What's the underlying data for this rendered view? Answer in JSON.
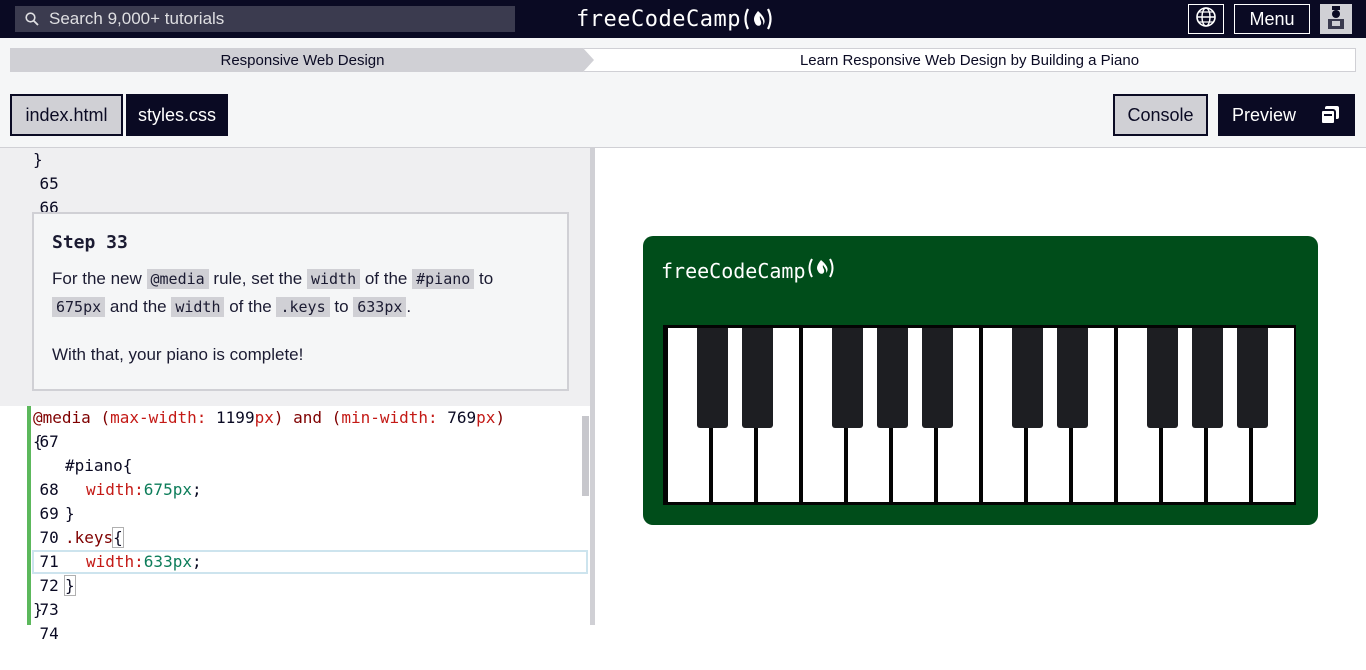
{
  "nav": {
    "search_placeholder": "Search 9,000+ tutorials",
    "brand": "freeCodeCamp",
    "menu_label": "Menu"
  },
  "breadcrumb": {
    "superblock": "Responsive Web Design",
    "block": "Learn Responsive Web Design by Building a Piano"
  },
  "tabs": {
    "index": "index.html",
    "styles": "styles.css",
    "console": "Console",
    "preview": "Preview"
  },
  "editor": {
    "line_numbers": [
      "65",
      "66",
      "67",
      "68",
      "69",
      "70",
      "71",
      "72",
      "73",
      "74"
    ],
    "line65": "}",
    "line68_selector": "#piano{",
    "line69_prop": "width:",
    "line69_val": "675px",
    "line69_end": ";",
    "line70": "}",
    "line71_selector": ".keys",
    "line71_brace": "{",
    "line72_prop": "width:",
    "line72_val": "633px",
    "line72_end": ";",
    "line73": "}",
    "line74": "}",
    "line67_at": "@media",
    "line67_open1": "(",
    "line67_p1": "max-width:",
    "line67_v1": " 1199",
    "line67_u1": "px",
    "line67_close1": ")",
    "line67_and": "and",
    "line67_open2": "(",
    "line67_p2": "min-width:",
    "line67_v2": " 769",
    "line67_u2": "px",
    "line67_close2": ")",
    "line67b": "{"
  },
  "step": {
    "title": "Step 33",
    "t1": "For the new ",
    "c1": "@media",
    "t2": " rule, set the ",
    "c2": "width",
    "t3": " of the ",
    "c3": "#piano",
    "t4": " to ",
    "c4": "675px",
    "t5": " and the ",
    "c5": "width",
    "t6": " of the ",
    "c6": ".keys",
    "t7": " to ",
    "c7": "633px",
    "t8": ".",
    "second": "With that, your piano is complete!"
  },
  "preview": {
    "logo": "freeCodeCamp",
    "white_keys": 14,
    "black_key_positions": [
      1,
      2,
      4,
      5,
      6,
      8,
      9,
      11,
      12,
      13
    ]
  },
  "colors": {
    "nav_bg": "#0a0a23",
    "piano_bg": "#004d1a",
    "gutter_accent": "#5cb85c"
  }
}
